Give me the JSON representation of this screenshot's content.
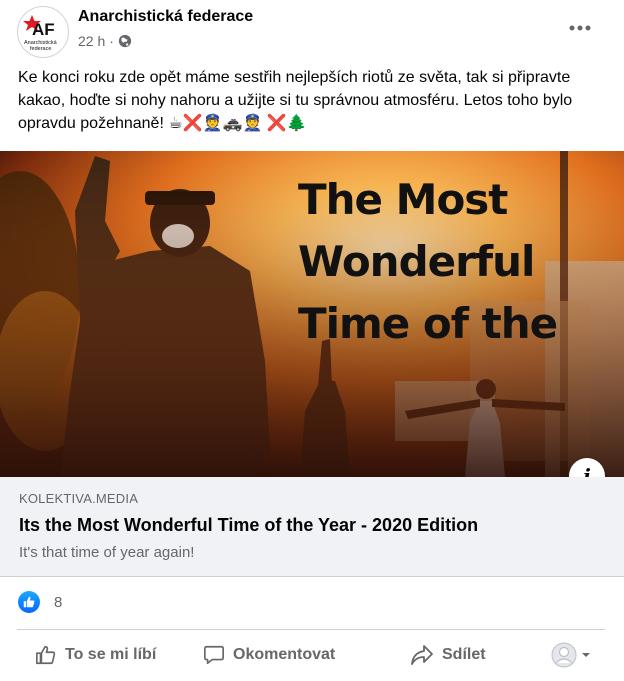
{
  "post": {
    "page_name": "Anarchistická federace",
    "avatar_text_main": "AF",
    "avatar_text_sub": "Anarchistická federace",
    "time": "22 h",
    "separator": "·",
    "audience_icon": "globe-icon",
    "text": "Ke konci roku zde opět máme sestřih nejlepších riotů ze světa, tak si připravte kakao, hoďte si nohy nahoru a užijte si tu správnou atmosféru. Letos toho bylo opravdu požehnaně! ☕❌👮🚓👮 ❌🌲"
  },
  "media": {
    "overlay_title": "The Most\nWonderful\nTime of the",
    "info_label": "i"
  },
  "link": {
    "domain": "KOLEKTIVA.MEDIA",
    "title": "Its the Most Wonderful Time of the Year - 2020 Edition",
    "description": "It's that time of year again!"
  },
  "reactions": {
    "count": "8",
    "type_icon": "like-icon"
  },
  "actions": {
    "like": "To se mi líbí",
    "comment": "Okomentovat",
    "share": "Sdílet"
  },
  "colors": {
    "accent": "#0866ff",
    "secondary_text": "#65676b",
    "link_bg": "#f0f2f5",
    "logo_red": "#e11b22"
  }
}
